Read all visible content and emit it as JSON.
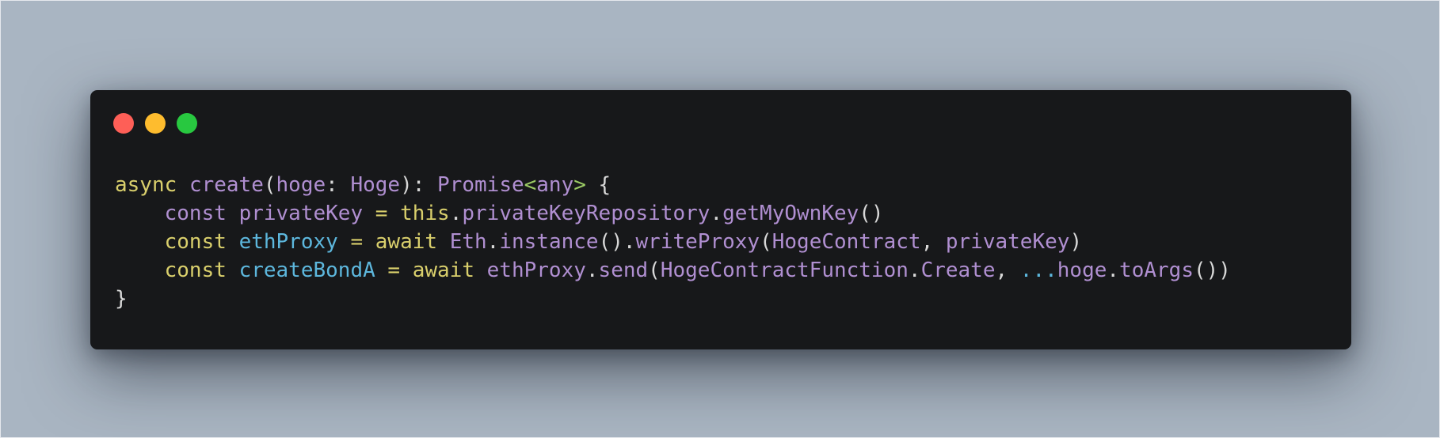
{
  "window": {
    "controls": [
      "close",
      "minimize",
      "maximize"
    ],
    "colors": {
      "close": "#fe5f57",
      "minimize": "#febc2e",
      "maximize": "#28c840",
      "background": "#17181a",
      "page_background": "#a9b5c2"
    }
  },
  "code": {
    "language": "typescript",
    "lines": [
      [
        {
          "t": "async",
          "c": "kw"
        },
        {
          "t": " ",
          "c": "punc"
        },
        {
          "t": "create",
          "c": "fn"
        },
        {
          "t": "(",
          "c": "punc"
        },
        {
          "t": "hoge",
          "c": "id"
        },
        {
          "t": ": ",
          "c": "punc"
        },
        {
          "t": "Hoge",
          "c": "ty"
        },
        {
          "t": "): ",
          "c": "punc"
        },
        {
          "t": "Promise",
          "c": "ty"
        },
        {
          "t": "<",
          "c": "gen"
        },
        {
          "t": "any",
          "c": "ty"
        },
        {
          "t": ">",
          "c": "gen"
        },
        {
          "t": " {",
          "c": "punc"
        }
      ],
      [
        {
          "t": "    ",
          "c": "punc"
        },
        {
          "t": "const",
          "c": "id"
        },
        {
          "t": " ",
          "c": "punc"
        },
        {
          "t": "privateKey",
          "c": "id"
        },
        {
          "t": " ",
          "c": "punc"
        },
        {
          "t": "=",
          "c": "op"
        },
        {
          "t": " ",
          "c": "punc"
        },
        {
          "t": "this",
          "c": "kw"
        },
        {
          "t": ".",
          "c": "punc"
        },
        {
          "t": "privateKeyRepository",
          "c": "id"
        },
        {
          "t": ".",
          "c": "punc"
        },
        {
          "t": "getMyOwnKey",
          "c": "fn"
        },
        {
          "t": "()",
          "c": "punc"
        }
      ],
      [
        {
          "t": "    ",
          "c": "punc"
        },
        {
          "t": "const",
          "c": "kw"
        },
        {
          "t": " ",
          "c": "punc"
        },
        {
          "t": "ethProxy",
          "c": "var"
        },
        {
          "t": " ",
          "c": "punc"
        },
        {
          "t": "=",
          "c": "op"
        },
        {
          "t": " ",
          "c": "punc"
        },
        {
          "t": "await",
          "c": "kw"
        },
        {
          "t": " ",
          "c": "punc"
        },
        {
          "t": "Eth",
          "c": "ty"
        },
        {
          "t": ".",
          "c": "punc"
        },
        {
          "t": "instance",
          "c": "fn"
        },
        {
          "t": "().",
          "c": "punc"
        },
        {
          "t": "writeProxy",
          "c": "fn"
        },
        {
          "t": "(",
          "c": "punc"
        },
        {
          "t": "HogeContract",
          "c": "ty"
        },
        {
          "t": ", ",
          "c": "punc"
        },
        {
          "t": "privateKey",
          "c": "id"
        },
        {
          "t": ")",
          "c": "punc"
        }
      ],
      [
        {
          "t": "    ",
          "c": "punc"
        },
        {
          "t": "const",
          "c": "kw"
        },
        {
          "t": " ",
          "c": "punc"
        },
        {
          "t": "createBondA",
          "c": "var"
        },
        {
          "t": " ",
          "c": "punc"
        },
        {
          "t": "=",
          "c": "op"
        },
        {
          "t": " ",
          "c": "punc"
        },
        {
          "t": "await",
          "c": "kw"
        },
        {
          "t": " ",
          "c": "punc"
        },
        {
          "t": "ethProxy",
          "c": "id"
        },
        {
          "t": ".",
          "c": "punc"
        },
        {
          "t": "send",
          "c": "fn"
        },
        {
          "t": "(",
          "c": "punc"
        },
        {
          "t": "HogeContractFunction",
          "c": "ty"
        },
        {
          "t": ".",
          "c": "punc"
        },
        {
          "t": "Create",
          "c": "id"
        },
        {
          "t": ", ",
          "c": "punc"
        },
        {
          "t": "...",
          "c": "spread"
        },
        {
          "t": "hoge",
          "c": "id"
        },
        {
          "t": ".",
          "c": "punc"
        },
        {
          "t": "toArgs",
          "c": "fn"
        },
        {
          "t": "())",
          "c": "punc"
        }
      ],
      [
        {
          "t": "}",
          "c": "punc"
        }
      ]
    ]
  }
}
